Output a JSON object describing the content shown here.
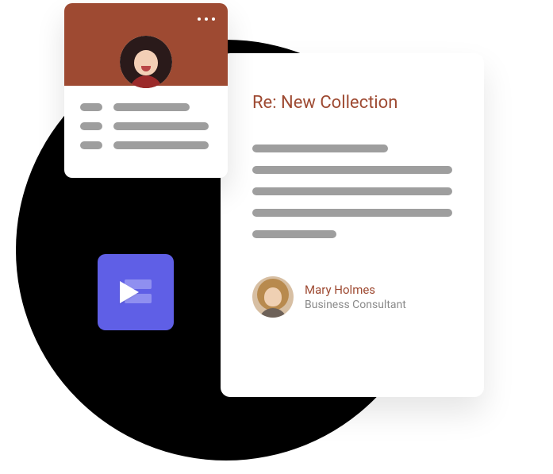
{
  "colors": {
    "brand_brown": "#9e4a32",
    "tile_purple": "#5f5fe6",
    "skeleton_gray": "#9e9e9e"
  },
  "profile_card": {
    "avatar": "person-smiling",
    "menu_icon": "more-horizontal"
  },
  "video_tile": {
    "icon": "play"
  },
  "email_card": {
    "subject": "Re: New Collection",
    "sender": {
      "name": "Mary Holmes",
      "title": "Business Consultant",
      "avatar": "person"
    }
  }
}
